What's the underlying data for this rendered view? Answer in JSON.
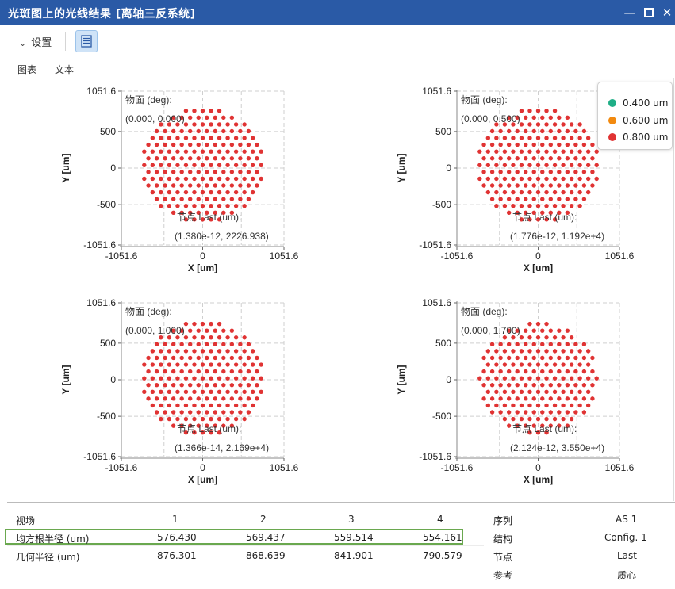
{
  "window": {
    "title": "光斑图上的光线结果 [离轴三反系统]",
    "minimize_icon": "minimize-icon",
    "maximize_icon": "maximize-icon",
    "close_icon": "close-icon"
  },
  "toolbar": {
    "settings_label": "设置",
    "list_icon": "list-icon"
  },
  "tabs": [
    {
      "label": "图表",
      "active": true
    },
    {
      "label": "文本",
      "active": false
    }
  ],
  "legend": {
    "items": [
      {
        "label": "0.400 um",
        "color": "#1fae86"
      },
      {
        "label": "0.600 um",
        "color": "#f28a0f"
      },
      {
        "label": "0.800 um",
        "color": "#e03333"
      }
    ]
  },
  "chart_data": [
    {
      "type": "scatter",
      "xlabel": "X [um]",
      "ylabel": "Y [um]",
      "xlim": [
        -1051.6,
        1051.6
      ],
      "ylim": [
        -1051.6,
        1051.6
      ],
      "xticks": [
        "-1051.6",
        "0",
        "1051.6"
      ],
      "yticks": [
        "1051.6",
        "500",
        "0",
        "-500",
        "-1051.6"
      ],
      "object_label": "物面 (deg):",
      "object_value": "(0.000, 0.000)",
      "image_label": "节点 Last (um):",
      "image_value": "(1.380e-12, 2226.938)",
      "spot_radius": 810,
      "spot_center": [
        0,
        40
      ]
    },
    {
      "type": "scatter",
      "xlabel": "X [um]",
      "ylabel": "Y [um]",
      "xlim": [
        -1051.6,
        1051.6
      ],
      "ylim": [
        -1051.6,
        1051.6
      ],
      "xticks": [
        "-1051.6",
        "0",
        "1051.6"
      ],
      "yticks": [
        "1051.6",
        "500",
        "0",
        "-500",
        "-1051.6"
      ],
      "object_label": "物面 (deg):",
      "object_value": "(0.000, 0.500)",
      "image_label": "节点 Last (um):",
      "image_value": "(1.776e-12, 1.192e+4)",
      "spot_radius": 805,
      "spot_center": [
        0,
        40
      ]
    },
    {
      "type": "scatter",
      "xlabel": "X [um]",
      "ylabel": "Y [um]",
      "xlim": [
        -1051.6,
        1051.6
      ],
      "ylim": [
        -1051.6,
        1051.6
      ],
      "xticks": [
        "-1051.6",
        "0",
        "1051.6"
      ],
      "yticks": [
        "1051.6",
        "500",
        "0",
        "-500",
        "-1051.6"
      ],
      "object_label": "物面 (deg):",
      "object_value": "(0.000, 1.000)",
      "image_label": "节点 Last (um):",
      "image_value": "(1.366e-14, 2.169e+4)",
      "spot_radius": 800,
      "spot_center": [
        0,
        20
      ]
    },
    {
      "type": "scatter",
      "xlabel": "X [um]",
      "ylabel": "Y [um]",
      "xlim": [
        -1051.6,
        1051.6
      ],
      "ylim": [
        -1051.6,
        1051.6
      ],
      "xticks": [
        "-1051.6",
        "0",
        "1051.6"
      ],
      "yticks": [
        "1051.6",
        "500",
        "0",
        "-500",
        "-1051.6"
      ],
      "object_label": "物面 (deg):",
      "object_value": "(0.000, 1.700)",
      "image_label": "节点 Last (um):",
      "image_value": "(2.124e-12, 3.550e+4)",
      "spot_radius": 760,
      "spot_center": [
        0,
        20
      ]
    }
  ],
  "results_table": {
    "header": [
      "视场",
      "1",
      "2",
      "3",
      "4"
    ],
    "rows": [
      {
        "label": "均方根半径 (um)",
        "values": [
          "576.430",
          "569.437",
          "559.514",
          "554.161"
        ],
        "highlighted": true
      },
      {
        "label": "几何半径 (um)",
        "values": [
          "876.301",
          "868.639",
          "841.901",
          "790.579"
        ],
        "highlighted": false
      }
    ]
  },
  "info_table": [
    {
      "key": "序列",
      "value": "AS 1"
    },
    {
      "key": "结构",
      "value": "Config. 1"
    },
    {
      "key": "节点",
      "value": "Last"
    },
    {
      "key": "参考",
      "value": "质心"
    }
  ]
}
